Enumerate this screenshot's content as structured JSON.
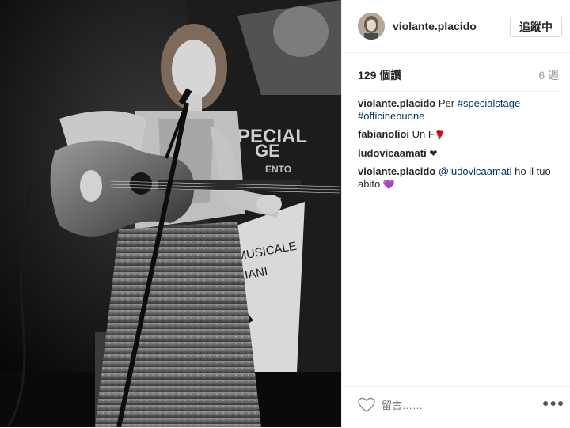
{
  "post": {
    "image_alt": "Black and white photo of a woman playing an acoustic guitar on stage with a microphone",
    "banner_lines": [
      "PECIAL",
      "GE",
      "ENTO",
      "NA MUSICALE",
      "ITALIANI"
    ]
  },
  "header": {
    "username": "violante.placido",
    "follow_label": "追蹤中",
    "avatar_icon": "avatar-icon"
  },
  "meta": {
    "views": "129 個讚",
    "age": "6 週"
  },
  "comments": [
    {
      "user": "violante.placido",
      "text": "Per ",
      "tag1": "#specialstage",
      "tag2": "#officinebuone"
    },
    {
      "user": "fabianolioi",
      "text": "Un F"
    },
    {
      "user": "ludovicaamati",
      "text": ""
    },
    {
      "user": "violante.placido",
      "mention": "@ludovicaamati",
      "text": " ho il tuo abito "
    }
  ],
  "footer": {
    "comment_placeholder": "留言……",
    "like_icon": "heart-outline-icon",
    "more_icon": "more-icon",
    "more_label": "●●●"
  },
  "colors": {
    "link": "#003569",
    "border": "#efefef",
    "muted": "#999999"
  }
}
